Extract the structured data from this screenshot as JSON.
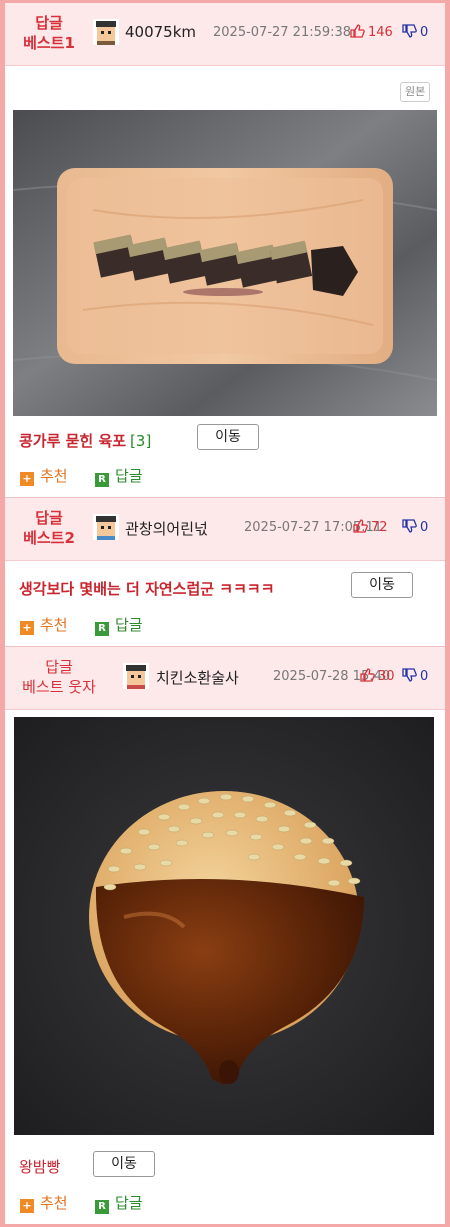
{
  "posts": [
    {
      "best_label_1": "답글",
      "best_label_2": "베스트1",
      "nick": "40075km",
      "date": "2025-07-27 21:59:38",
      "up": "146",
      "down": "0",
      "original_label": "원본",
      "title": "콩가루 묻힌 육포",
      "comment_count": "[3]",
      "move_label": "이동",
      "recommend_label": "추천",
      "reply_label": "답글"
    },
    {
      "best_label_1": "답글",
      "best_label_2": "베스트2",
      "nick": "관창의어린넋",
      "date": "2025-07-27 17:05:11",
      "up": "72",
      "down": "0",
      "title": "생각보다 몇배는 더 자연스럽군 ㅋㅋㅋㅋ",
      "move_label": "이동",
      "recommend_label": "추천",
      "reply_label": "답글"
    },
    {
      "best_label_1": "답글",
      "best_label_2": "베스트 웃자",
      "nick": "치킨소환술사",
      "date": "2025-07-28 15:40",
      "up": "30",
      "down": "0",
      "title": "왕밤빵",
      "move_label": "이동",
      "recommend_label": "추천",
      "reply_label": "답글"
    }
  ],
  "icons": {
    "thumbs_up": "thumbs-up-icon",
    "thumbs_down": "thumbs-down-icon",
    "recommend": "plus-square-icon",
    "reply": "r-square-icon",
    "reply_glyph": "R",
    "recommend_glyph": "+"
  },
  "colors": {
    "border": "#f4a9a8",
    "header_bg": "#fde8ea",
    "accent_red": "#d8313a",
    "recommend_orange": "#e4731f",
    "reply_green": "#2f8b2f",
    "down_blue": "#2233aa"
  }
}
